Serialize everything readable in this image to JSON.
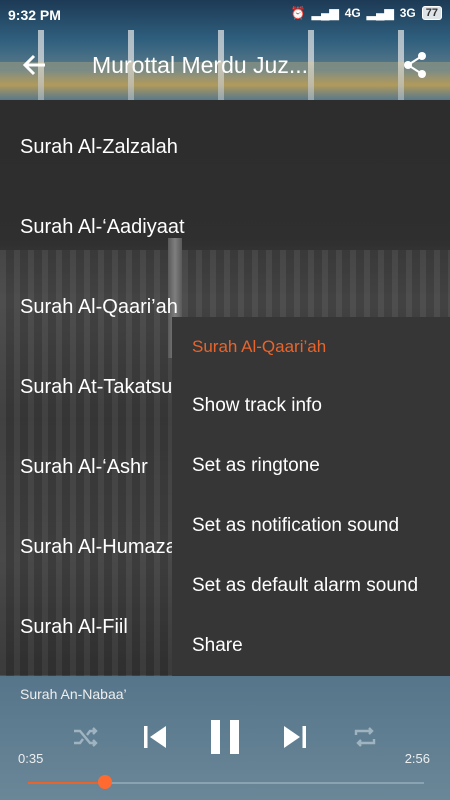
{
  "status": {
    "time": "9:32 PM",
    "signal1": "4G",
    "signal2": "3G",
    "battery": "77"
  },
  "header": {
    "title": "Murottal Merdu Juz..."
  },
  "list": {
    "items": [
      "Surah Al-Zalzalah",
      "Surah Al-‘Aadiyaat",
      "Surah Al-Qaari’ah",
      "Surah At-Takatsur",
      "Surah Al-‘Ashr",
      "Surah Al-Humazah",
      "Surah Al-Fiil"
    ]
  },
  "menu": {
    "header": "Surah Al-Qaari’ah",
    "items": [
      "Show track info",
      "Set as ringtone",
      "Set as notification sound",
      "Set as default alarm sound",
      "Share"
    ]
  },
  "player": {
    "now_playing": "Surah An-Nabaa’",
    "current_time": "0:35",
    "duration": "2:56",
    "progress": 0.2
  },
  "colors": {
    "accent": "#e8642c",
    "menu_bg": "#363636",
    "player_bg": "#5f7d8f"
  },
  "icons": [
    "back-arrow-icon",
    "share-icon",
    "shuffle-icon",
    "previous-icon",
    "pause-icon",
    "next-icon",
    "repeat-icon"
  ]
}
